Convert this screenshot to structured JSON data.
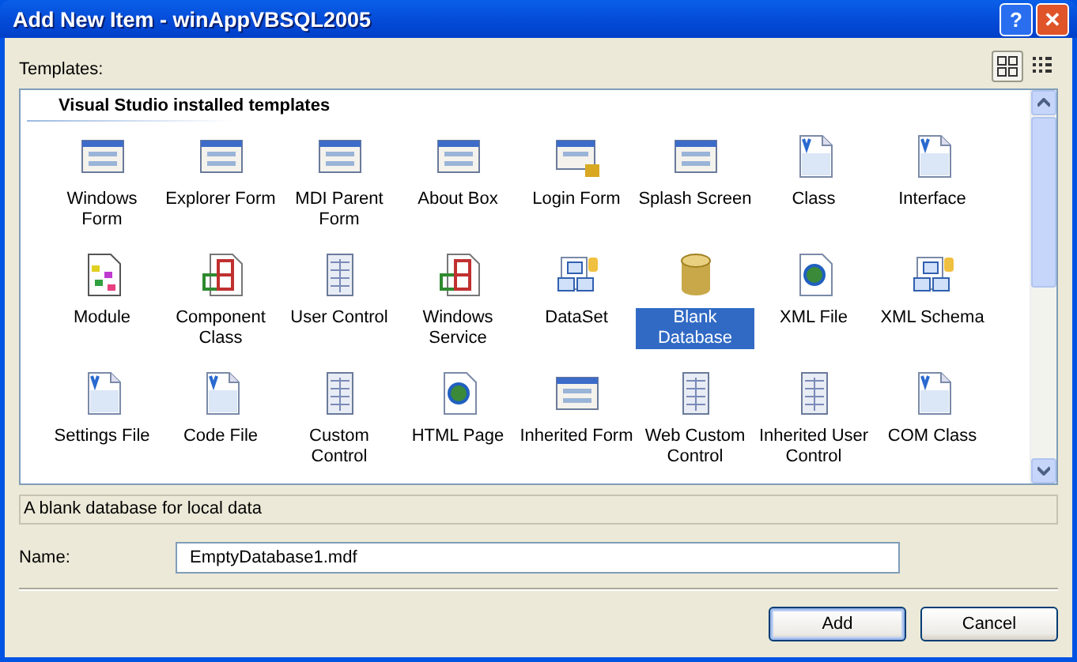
{
  "window": {
    "title": "Add New Item - winAppVBSQL2005",
    "buttons": [
      {
        "kind": "help",
        "label": "?"
      },
      {
        "kind": "close",
        "label": "✕"
      }
    ]
  },
  "view_buttons": [
    {
      "kind": "large",
      "selected": true
    },
    {
      "kind": "small",
      "selected": false
    }
  ],
  "templates": {
    "label": "Templates:",
    "heading": "Visual Studio installed templates",
    "items": [
      {
        "label": "Windows Form",
        "kind": "form",
        "selected": false
      },
      {
        "label": "Explorer Form",
        "kind": "form",
        "selected": false
      },
      {
        "label": "MDI Parent Form",
        "kind": "form",
        "selected": false
      },
      {
        "label": "About Box",
        "kind": "form",
        "selected": false
      },
      {
        "label": "Login Form",
        "kind": "lockform",
        "selected": false
      },
      {
        "label": "Splash Screen",
        "kind": "form",
        "selected": false
      },
      {
        "label": "Class",
        "kind": "vbfile",
        "selected": false
      },
      {
        "label": "Interface",
        "kind": "vbfile",
        "selected": false
      },
      {
        "label": "Module",
        "kind": "module",
        "selected": false
      },
      {
        "label": "Component Class",
        "kind": "squares",
        "selected": false
      },
      {
        "label": "User Control",
        "kind": "grid",
        "selected": false
      },
      {
        "label": "Windows Service",
        "kind": "squares",
        "selected": false
      },
      {
        "label": "DataSet",
        "kind": "dataset",
        "selected": false
      },
      {
        "label": "Blank Database",
        "kind": "database",
        "selected": true
      },
      {
        "label": "XML File",
        "kind": "globefile",
        "selected": false
      },
      {
        "label": "XML Schema",
        "kind": "dataset",
        "selected": false
      },
      {
        "label": "Settings File",
        "kind": "vbfile",
        "selected": false
      },
      {
        "label": "Code File",
        "kind": "vbfile",
        "selected": false
      },
      {
        "label": "Custom Control",
        "kind": "grid",
        "selected": false
      },
      {
        "label": "HTML Page",
        "kind": "globefile",
        "selected": false
      },
      {
        "label": "Inherited Form",
        "kind": "form",
        "selected": false
      },
      {
        "label": "Web Custom Control",
        "kind": "grid",
        "selected": false
      },
      {
        "label": "Inherited User Control",
        "kind": "grid",
        "selected": false
      },
      {
        "label": "COM Class",
        "kind": "vbfile",
        "selected": false
      }
    ]
  },
  "description": "A blank database for local data",
  "name_field": {
    "label": "Name:",
    "value": "EmptyDatabase1.mdf"
  },
  "buttons": [
    {
      "label": "Add",
      "kind": "default"
    },
    {
      "label": "Cancel",
      "kind": "normal"
    }
  ]
}
